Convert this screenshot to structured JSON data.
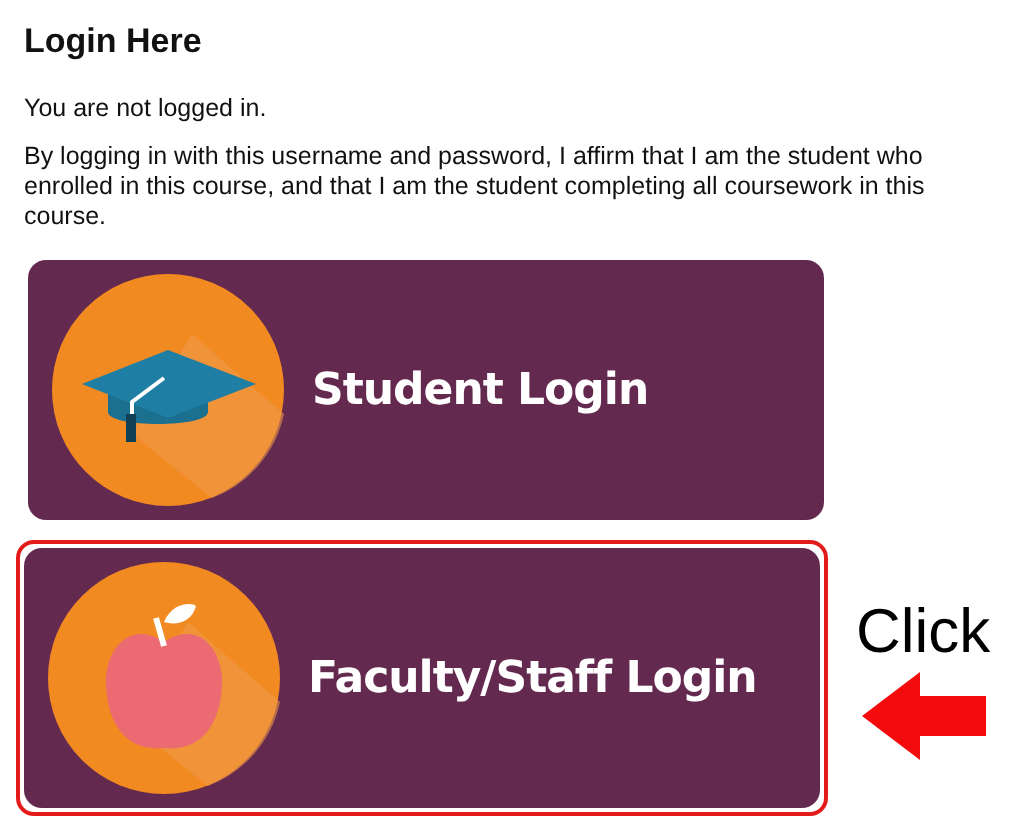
{
  "heading": "Login Here",
  "status": "You are not logged in.",
  "notice": "By logging in with this username and password, I affirm that I am the student who enrolled in this course, and that I am the student completing all coursework in this course.",
  "login_buttons": [
    {
      "label": "Student Login",
      "kind": "student",
      "highlighted": false
    },
    {
      "label": "Faculty/Staff Login",
      "kind": "faculty",
      "highlighted": true,
      "annotation": "Click"
    }
  ]
}
